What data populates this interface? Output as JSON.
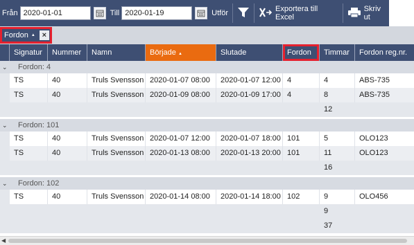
{
  "toolbar": {
    "from_label": "Från",
    "from_date": "2020-01-01",
    "to_label": "Till",
    "to_date": "2020-01-19",
    "run_label": "Utför",
    "export_label": "Exportera till Excel",
    "print_label": "Skriv ut"
  },
  "group_panel": {
    "chip_label": "Fordon",
    "chip_sort": "▲",
    "chip_close": "×"
  },
  "columns": [
    {
      "key": "signatur",
      "label": "Signatur"
    },
    {
      "key": "nummer",
      "label": "Nummer"
    },
    {
      "key": "namn",
      "label": "Namn"
    },
    {
      "key": "borjade",
      "label": "Började",
      "sort": "▲"
    },
    {
      "key": "slutade",
      "label": "Slutade"
    },
    {
      "key": "fordon",
      "label": "Fordon"
    },
    {
      "key": "timmar",
      "label": "Timmar"
    },
    {
      "key": "regnr",
      "label": "Fordon reg.nr."
    }
  ],
  "groups": [
    {
      "label": "Fordon: 4",
      "rows": [
        {
          "signatur": "TS",
          "nummer": "40",
          "namn": "Truls Svensson",
          "borjade": "2020-01-07 08:00",
          "slutade": "2020-01-07 12:00",
          "fordon": "4",
          "timmar": "4",
          "regnr": "ABS-735"
        },
        {
          "signatur": "TS",
          "nummer": "40",
          "namn": "Truls Svensson",
          "borjade": "2020-01-09 08:00",
          "slutade": "2020-01-09 17:00",
          "fordon": "4",
          "timmar": "8",
          "regnr": "ABS-735"
        }
      ],
      "sum": "12"
    },
    {
      "label": "Fordon: 101",
      "rows": [
        {
          "signatur": "TS",
          "nummer": "40",
          "namn": "Truls Svensson",
          "borjade": "2020-01-07 12:00",
          "slutade": "2020-01-07 18:00",
          "fordon": "101",
          "timmar": "5",
          "regnr": "OLO123"
        },
        {
          "signatur": "TS",
          "nummer": "40",
          "namn": "Truls Svensson",
          "borjade": "2020-01-13 08:00",
          "slutade": "2020-01-13 20:00",
          "fordon": "101",
          "timmar": "11",
          "regnr": "OLO123"
        }
      ],
      "sum": "16"
    },
    {
      "label": "Fordon: 102",
      "rows": [
        {
          "signatur": "TS",
          "nummer": "40",
          "namn": "Truls Svensson",
          "borjade": "2020-01-14 08:00",
          "slutade": "2020-01-14 18:00",
          "fordon": "102",
          "timmar": "9",
          "regnr": "OLO456"
        }
      ],
      "sum": "9"
    }
  ],
  "grand_total": "37",
  "colors": {
    "header_bg": "#3e4f73",
    "sorted_col": "#ea6b10",
    "highlight": "#e5202e"
  },
  "icons": {
    "calendar": "calendar-icon",
    "filter": "filter-icon",
    "export": "excel-export-icon",
    "print": "printer-icon"
  }
}
